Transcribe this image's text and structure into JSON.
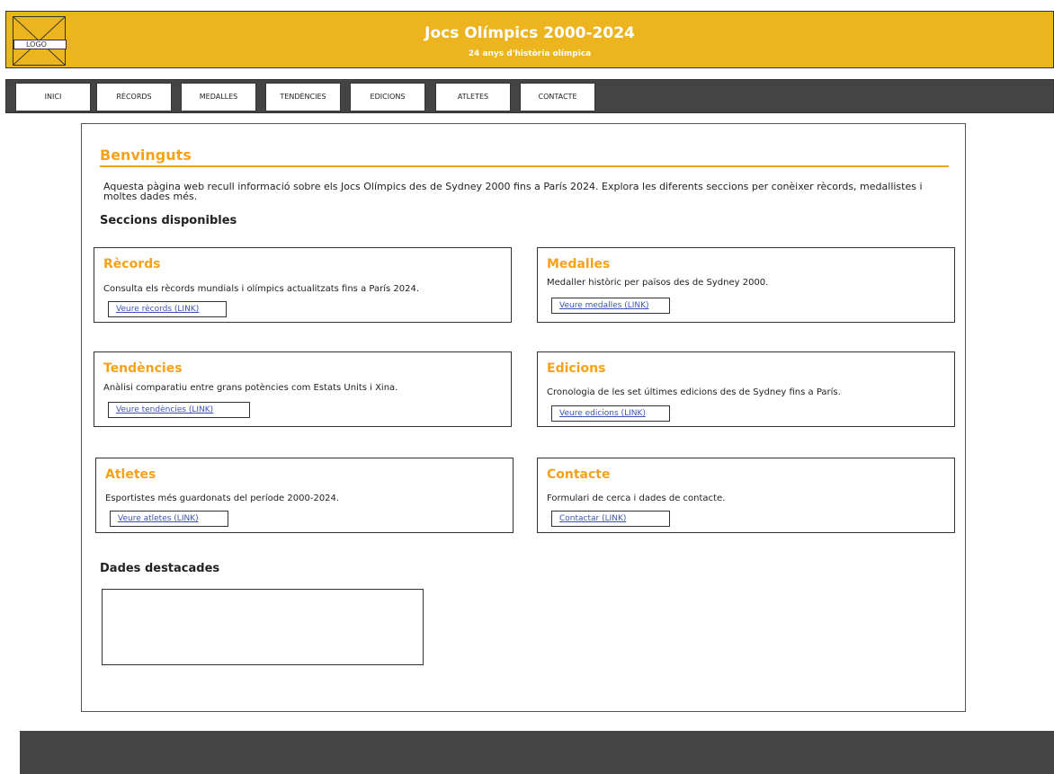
{
  "header": {
    "logo_label": "LOGO",
    "title": "Jocs Olímpics 2000-2024",
    "subtitle": "24 anys d'història olímpica",
    "background_color": "#ecb41e"
  },
  "nav": {
    "items": [
      {
        "label": "INICI"
      },
      {
        "label": "RÈCORDS"
      },
      {
        "label": "MEDALLES"
      },
      {
        "label": "TENDÈNCIES"
      },
      {
        "label": "EDICIONS"
      },
      {
        "label": "ATLETES"
      },
      {
        "label": "CONTACTE"
      }
    ],
    "background_color": "#444444"
  },
  "main": {
    "welcome_title": "Benvinguts",
    "intro_text": "Aquesta pàgina web recull informació sobre els Jocs Olímpics des de Sydney 2000 fins a París 2024. Explora les diferents seccions per conèixer rècords, medallistes i moltes dades més.",
    "sections_heading": "Seccions disponibles",
    "cards": [
      {
        "title": "Rècords",
        "description": "Consulta els rècords mundials i olímpics actualitzats fins a París 2024.",
        "link": "Veure rècords (LINK)"
      },
      {
        "title": "Medalles",
        "description": "Medaller històric per països des de Sydney 2000.",
        "link": "Veure medalles (LINK)"
      },
      {
        "title": "Tendències",
        "description": "Anàlisi comparatiu entre grans potències com Estats Units i Xina.",
        "link": "Veure tendències (LINK)"
      },
      {
        "title": "Edicions",
        "description": "Cronologia de les set últimes edicions des de Sydney fins a París.",
        "link": "Veure edicions (LINK)"
      },
      {
        "title": "Atletes",
        "description": "Esportistes més guardonats del període 2000-2024.",
        "link": "Veure atletes (LINK)"
      },
      {
        "title": "Contacte",
        "description": "Formulari de cerca i dades de contacte.",
        "link": "Contactar (LINK)"
      }
    ],
    "featured_heading": "Dades destacades",
    "accent_color": "#f5a21b",
    "link_color": "#3b53b8"
  },
  "footer": {
    "background_color": "#444444"
  }
}
